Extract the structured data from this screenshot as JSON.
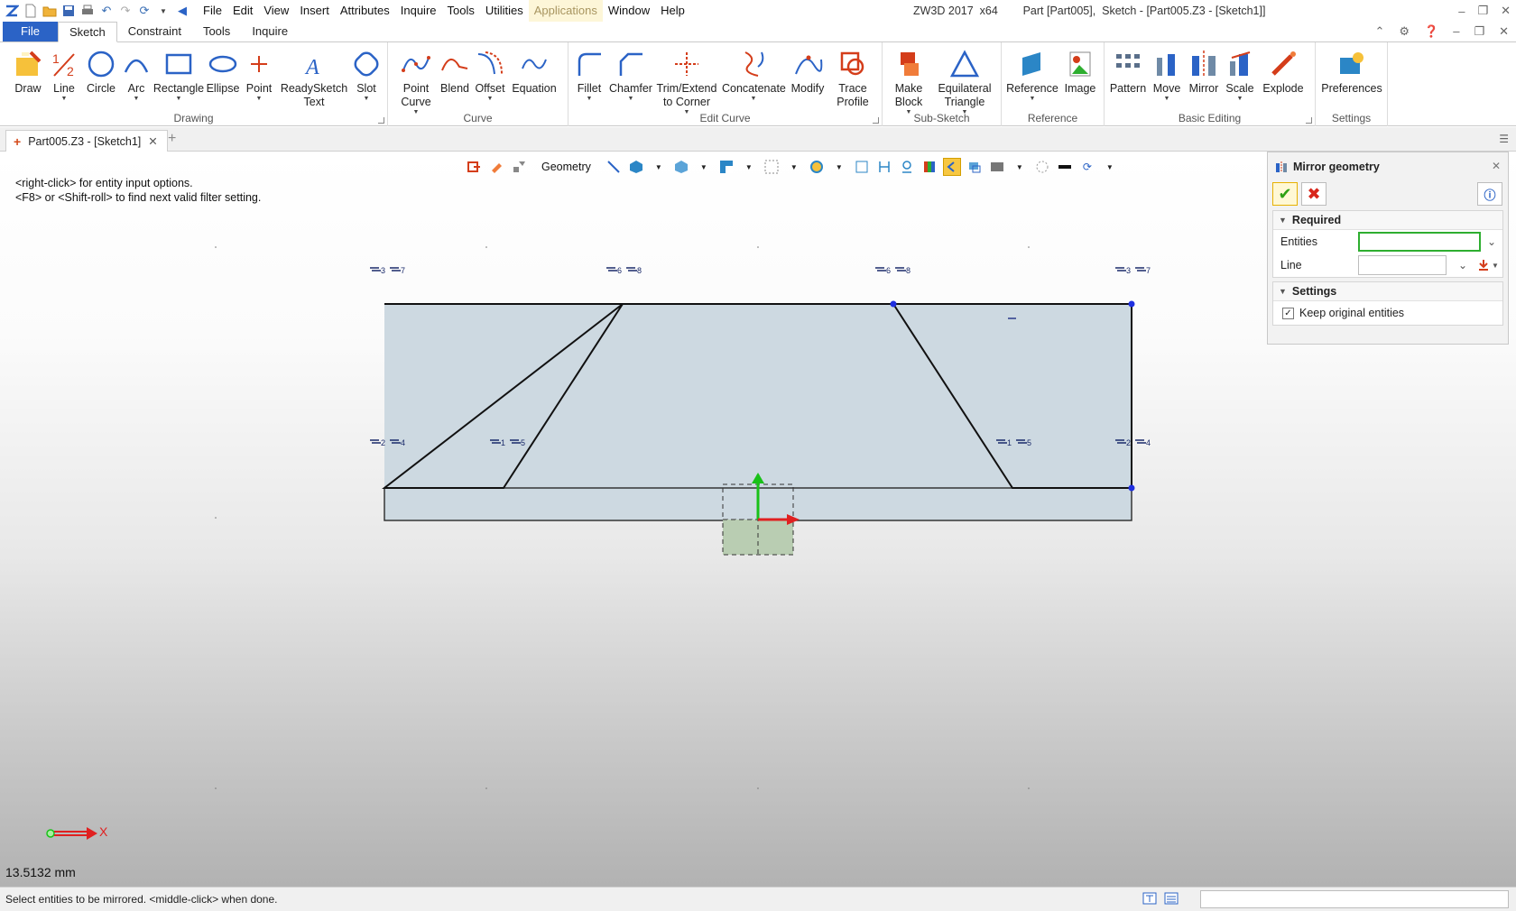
{
  "app": {
    "title": "ZW3D 2017  x64        Part [Part005],  Sketch - [Part005.Z3 - [Sketch1]]"
  },
  "menu": [
    "File",
    "Edit",
    "View",
    "Insert",
    "Attributes",
    "Inquire",
    "Tools",
    "Utilities",
    "Applications",
    "Window",
    "Help"
  ],
  "ribbon_tabs": [
    "File",
    "Sketch",
    "Constraint",
    "Tools",
    "Inquire"
  ],
  "ribbon": {
    "drawing": {
      "label": "Drawing",
      "buttons": [
        "Draw",
        "Line",
        "Circle",
        "Arc",
        "Rectangle",
        "Ellipse",
        "Point",
        "ReadySketch Text",
        "Slot"
      ]
    },
    "curve": {
      "label": "Curve",
      "buttons": [
        "Point Curve",
        "Blend",
        "Offset",
        "Equation"
      ]
    },
    "edit_curve": {
      "label": "Edit Curve",
      "buttons": [
        "Fillet",
        "Chamfer",
        "Trim/Extend to Corner",
        "Concatenate",
        "Modify",
        "Trace Profile"
      ]
    },
    "sub_sketch": {
      "label": "Sub-Sketch",
      "buttons": [
        "Make Block",
        "Equilateral Triangle"
      ]
    },
    "reference": {
      "label": "Reference",
      "buttons": [
        "Reference",
        "Image"
      ]
    },
    "basic_editing": {
      "label": "Basic Editing",
      "buttons": [
        "Pattern",
        "Move",
        "Mirror",
        "Scale",
        "Explode"
      ]
    },
    "settings": {
      "label": "Settings",
      "buttons": [
        "Preferences"
      ]
    }
  },
  "doc_tab": "Part005.Z3 - [Sketch1]",
  "canvas": {
    "hint1": "<right-click> for entity input options.",
    "hint2": "<F8> or <Shift-roll> to find next valid filter setting.",
    "filter_label": "Geometry",
    "measure": "13.5132 mm",
    "x_axis_label": "X",
    "constraint_labels": [
      "3",
      "7",
      "6",
      "8",
      "6",
      "8",
      "3",
      "7",
      "2",
      "4",
      "1",
      "5",
      "1",
      "5",
      "2",
      "4"
    ]
  },
  "panel": {
    "title": "Mirror geometry",
    "required_label": "Required",
    "entities_label": "Entities",
    "entities_value": "",
    "line_label": "Line",
    "line_value": "",
    "settings_label": "Settings",
    "keep_original_label": "Keep original entities",
    "keep_original_checked": true
  },
  "status": {
    "text": "Select entities to be mirrored.  <middle-click> when done."
  },
  "colors": {
    "file_tab": "#2b63c6",
    "sketch_fill": "#cdd9e1",
    "ok_green": "#2ea014",
    "cancel_red": "#d8251a",
    "axis_red": "#e02020",
    "axis_green": "#19c119"
  }
}
